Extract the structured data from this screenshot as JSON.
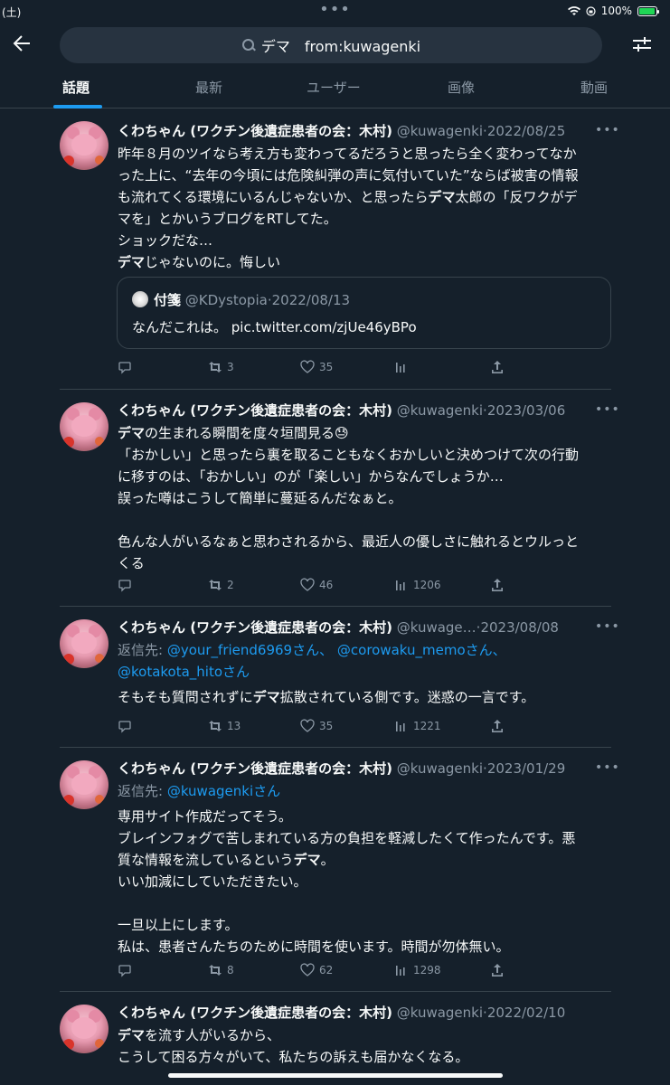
{
  "status_bar": {
    "time": "(土)",
    "battery": "100%",
    "battery_level": 1.0
  },
  "search": {
    "query": "デマ　from:kuwagenki"
  },
  "tabs": [
    {
      "label": "話題",
      "active": true
    },
    {
      "label": "最新",
      "active": false
    },
    {
      "label": "ユーザー",
      "active": false
    },
    {
      "label": "画像",
      "active": false
    },
    {
      "label": "動画",
      "active": false
    }
  ],
  "tweets": [
    {
      "name": "くわちゃん (ワクチン後遺症患者の会：木村)",
      "handle": "@kuwagenki",
      "sep": "·",
      "date": "2022/08/25",
      "lines": [
        "昨年８月のツイなら考え方も変わってるだろうと思ったら全く変わってなか",
        "った上に、“去年の今頃には危険糾弾の声に気付いていた”ならば被害の情報",
        "も流れてくる環境にいるんじゃないか、と思ったらデマ太郎の「反ワクがデ",
        "マを」とかいうブログをRTしてた。",
        "ショックだな…",
        "デマじゃないのに。悔しい"
      ],
      "quote": {
        "name": "付箋",
        "handle": "@KDystopia",
        "sep": "·",
        "date": "2022/08/13",
        "text": "なんだこれは。 pic.twitter.com/zjUe46yBPo"
      },
      "replies": "",
      "retweets": "3",
      "likes": "35",
      "views": ""
    },
    {
      "name": "くわちゃん (ワクチン後遺症患者の会：木村)",
      "handle": "@kuwagenki",
      "sep": "·",
      "date": "2023/03/06",
      "lines": [
        "デマの生まれる瞬間を度々垣間見る😓",
        "「おかしい」と思ったら裏を取ることもなくおかしいと決めつけて次の行動",
        "に移すのは、「おかしい」のが「楽しい」からなんでしょうか…",
        "誤った噂はこうして簡単に蔓延るんだなぁと。",
        "",
        "色んな人がいるなぁと思わされるから、最近人の優しさに触れるとウルっと",
        "くる"
      ],
      "replies": "",
      "retweets": "2",
      "likes": "46",
      "views": "1206"
    },
    {
      "name": "くわちゃん (ワクチン後遺症患者の会：木村)",
      "handle": "@kuwage…",
      "sep": "·",
      "date": "2023/08/08",
      "reply_prefix": "返信先: ",
      "reply_users_1": "@your_friend6969",
      "reply_san_1": "さん、",
      "reply_users_2": "@corowaku_memo",
      "reply_san_2": "さん、",
      "reply_users_3": "@kotakota_hito",
      "reply_san_3": "さん",
      "lines": [
        "そもそも質問されずにデマ拡散されている側です。迷惑の一言です。"
      ],
      "replies": "",
      "retweets": "13",
      "likes": "35",
      "views": "1221"
    },
    {
      "name": "くわちゃん (ワクチン後遺症患者の会：木村)",
      "handle": "@kuwagenki",
      "sep": "·",
      "date": "2023/01/29",
      "reply_prefix": "返信先: ",
      "reply_users_1": "@kuwagenki",
      "reply_san_1": "さん",
      "lines": [
        "専用サイト作成だってそう。",
        "ブレインフォグで苦しまれている方の負担を軽減したくて作ったんです。悪",
        "質な情報を流しているというデマ。",
        "いい加減にしていただきたい。",
        "",
        "一旦以上にします。",
        "私は、患者さんたちのために時間を使います。時間が勿体無い。"
      ],
      "replies": "",
      "retweets": "8",
      "likes": "62",
      "views": "1298"
    },
    {
      "name": "くわちゃん (ワクチン後遺症患者の会：木村)",
      "handle": "@kuwagenki",
      "sep": "·",
      "date": "2022/02/10",
      "lines": [
        "デマを流す人がいるから、",
        "こうして困る方々がいて、私たちの訴えも届かなくなる。"
      ]
    }
  ]
}
